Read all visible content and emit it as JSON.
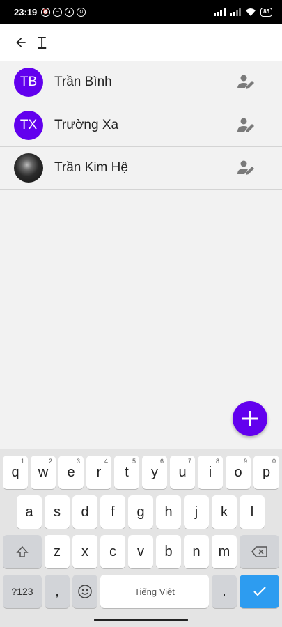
{
  "status_bar": {
    "time": "23:19",
    "battery": "85"
  },
  "search": {
    "query": "T"
  },
  "contacts": [
    {
      "initials": "TB",
      "name": "Trần Bình",
      "avatar_color": "#6200ee"
    },
    {
      "initials": "TX",
      "name": "Trường Xa",
      "avatar_color": "#6200ee"
    },
    {
      "initials": "",
      "name": "Trần Kim Hệ",
      "avatar": "photo"
    }
  ],
  "keyboard": {
    "row1": [
      {
        "key": "q",
        "hint": "1"
      },
      {
        "key": "w",
        "hint": "2"
      },
      {
        "key": "e",
        "hint": "3"
      },
      {
        "key": "r",
        "hint": "4"
      },
      {
        "key": "t",
        "hint": "5"
      },
      {
        "key": "y",
        "hint": "6"
      },
      {
        "key": "u",
        "hint": "7"
      },
      {
        "key": "i",
        "hint": "8"
      },
      {
        "key": "o",
        "hint": "9"
      },
      {
        "key": "p",
        "hint": "0"
      }
    ],
    "row2": [
      "a",
      "s",
      "d",
      "f",
      "g",
      "h",
      "j",
      "k",
      "l"
    ],
    "row3": [
      "z",
      "x",
      "c",
      "v",
      "b",
      "n",
      "m"
    ],
    "symbols_label": "?123",
    "comma": ",",
    "space_label": "Tiếng Việt",
    "period": "."
  },
  "colors": {
    "accent": "#6200ee",
    "enter": "#2d9cf0"
  }
}
